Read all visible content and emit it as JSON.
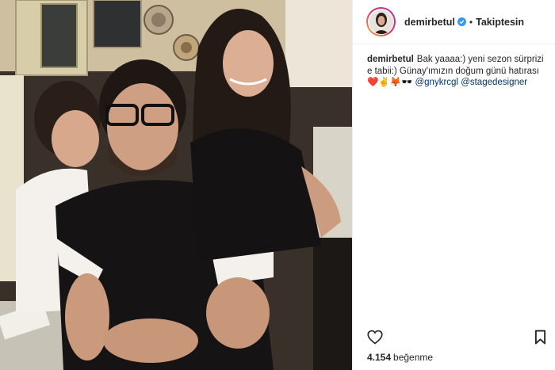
{
  "header": {
    "username": "demirbetul",
    "separator": "•",
    "follow_label": "Takiptesin"
  },
  "caption": {
    "username": "demirbetul",
    "text": "Bak yaaaa:) yeni sezon sürprizi e tabii:) Günay'ımızın doğum günü hatırası",
    "emojis": "❤️✌🦊🕶️",
    "mention_1": "@gnykrcgl",
    "mention_2": "@stagedesigner"
  },
  "actions": {
    "like_icon": "heart-icon",
    "save_icon": "bookmark-icon",
    "likes_count": "4.154",
    "likes_word": "beğenme"
  },
  "colors": {
    "link": "#003569",
    "verified": "#3897f0",
    "border": "#efefef"
  }
}
